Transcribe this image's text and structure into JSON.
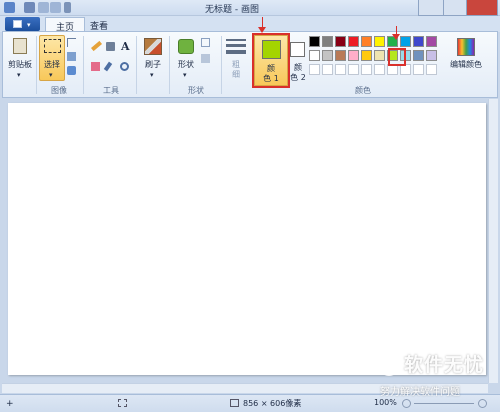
{
  "titlebar": {
    "title": "无标题 - 画图"
  },
  "tabs": {
    "file_arrow": "▾",
    "home": "主页",
    "view": "查看"
  },
  "ribbon": {
    "clipboard": {
      "paste_label": "剪贴板",
      "group": ""
    },
    "image": {
      "select_label": "选择",
      "group": "图像"
    },
    "tools": {
      "group": "工具",
      "text_tool": "A"
    },
    "brushes": {
      "label": "刷子"
    },
    "shapes": {
      "label": "形状",
      "group": "形状"
    },
    "outline": {
      "label": "粗\n细"
    },
    "color1": {
      "label_line1": "颜",
      "label_line2": "色 1",
      "color": "#a4d400"
    },
    "color2": {
      "label_line1": "颜",
      "label_line2": "色 2",
      "color": "#ffffff"
    },
    "colors_group": "颜色",
    "edit_colors": "编辑颜色",
    "palette_row1": [
      "#000000",
      "#7f7f7f",
      "#880015",
      "#ed1c24",
      "#ff7f27",
      "#fff200",
      "#22b14c",
      "#00a2e8",
      "#3f48cc",
      "#a349a4"
    ],
    "palette_row2": [
      "#ffffff",
      "#c3c3c3",
      "#b97a57",
      "#ffaec9",
      "#ffc90e",
      "#efe4b0",
      "#b5e61d",
      "#99d9ea",
      "#7092be",
      "#c8bfe7"
    ],
    "palette_row3": [
      "#ffffff",
      "#ffffff",
      "#ffffff",
      "#ffffff",
      "#ffffff",
      "#ffffff",
      "#ffffff",
      "#ffffff",
      "#ffffff",
      "#ffffff"
    ]
  },
  "statusbar": {
    "canvas_size": "856 × 606像素",
    "zoom": "100%"
  },
  "watermark": {
    "line1": "软件无忧",
    "line2": "努力解决软件问题"
  }
}
